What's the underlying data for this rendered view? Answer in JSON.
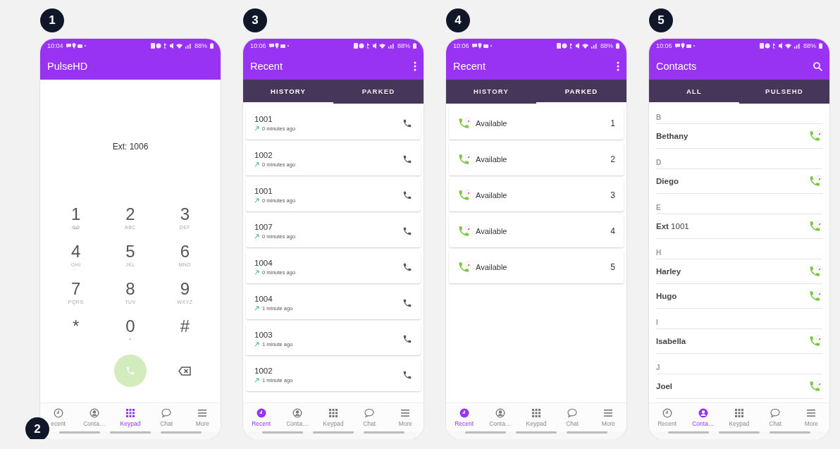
{
  "phones": [
    {
      "badge": "1",
      "corner_badge": "2",
      "status": {
        "time": "10:04",
        "battery": "88%"
      },
      "title": "PulseHD",
      "kind": "keypad",
      "extension": "Ext: 1006",
      "keys": [
        {
          "digit": "1",
          "voicemail": true
        },
        {
          "digit": "2",
          "letters": "ABC"
        },
        {
          "digit": "3",
          "letters": "DEF"
        },
        {
          "digit": "4",
          "letters": "GHI"
        },
        {
          "digit": "5",
          "letters": "JKL"
        },
        {
          "digit": "6",
          "letters": "MNO"
        },
        {
          "digit": "7",
          "letters": "PQRS"
        },
        {
          "digit": "8",
          "letters": "TUV"
        },
        {
          "digit": "9",
          "letters": "WXYZ"
        },
        {
          "digit": "*"
        },
        {
          "digit": "0",
          "letters": "+"
        },
        {
          "digit": "#"
        }
      ],
      "nav": [
        {
          "label": "ecent",
          "selected": false
        },
        {
          "label": "Conta…",
          "selected": false
        },
        {
          "label": "Keypad",
          "selected": true
        },
        {
          "label": "Chat",
          "selected": false
        },
        {
          "label": "More",
          "selected": false
        }
      ]
    },
    {
      "badge": "3",
      "status": {
        "time": "10:06",
        "battery": "88%"
      },
      "title": "Recent",
      "menu_button": true,
      "kind": "history",
      "tabs": [
        {
          "label": "HISTORY",
          "selected": true
        },
        {
          "label": "PARKED",
          "selected": false
        }
      ],
      "calls": [
        {
          "number": "1001",
          "time": "0 minutes ago"
        },
        {
          "number": "1002",
          "time": "0 minutes ago"
        },
        {
          "number": "1001",
          "time": "0 minutes ago"
        },
        {
          "number": "1007",
          "time": "0 minutes ago"
        },
        {
          "number": "1004",
          "time": "0 minutes ago"
        },
        {
          "number": "1004",
          "time": "1 minute ago"
        },
        {
          "number": "1003",
          "time": "1 minute ago"
        },
        {
          "number": "1002",
          "time": "1 minute ago"
        }
      ],
      "nav": [
        {
          "label": "Recent",
          "selected": true
        },
        {
          "label": "Conta…",
          "selected": false
        },
        {
          "label": "Keypad",
          "selected": false
        },
        {
          "label": "Chat",
          "selected": false
        },
        {
          "label": "More",
          "selected": false
        }
      ]
    },
    {
      "badge": "4",
      "status": {
        "time": "10:06",
        "battery": "88%"
      },
      "title": "Recent",
      "menu_button": true,
      "kind": "parked",
      "tabs": [
        {
          "label": "HISTORY",
          "selected": false
        },
        {
          "label": "PARKED",
          "selected": true
        }
      ],
      "slots": [
        {
          "label": "Available",
          "number": "1"
        },
        {
          "label": "Available",
          "number": "2"
        },
        {
          "label": "Available",
          "number": "3"
        },
        {
          "label": "Available",
          "number": "4"
        },
        {
          "label": "Available",
          "number": "5"
        }
      ],
      "nav": [
        {
          "label": "Recent",
          "selected": true
        },
        {
          "label": "Conta…",
          "selected": false
        },
        {
          "label": "Keypad",
          "selected": false
        },
        {
          "label": "Chat",
          "selected": false
        },
        {
          "label": "More",
          "selected": false
        }
      ]
    },
    {
      "badge": "5",
      "status": {
        "time": "10:06",
        "battery": "88%"
      },
      "title": "Contacts",
      "search_button": true,
      "kind": "contacts",
      "tabs": [
        {
          "label": "ALL",
          "selected": true
        },
        {
          "label": "PULSEHD",
          "selected": false
        }
      ],
      "sections": [
        {
          "letter": "B",
          "contacts": [
            {
              "name": "Bethany"
            }
          ]
        },
        {
          "letter": "D",
          "contacts": [
            {
              "name": "Diego"
            }
          ]
        },
        {
          "letter": "E",
          "contacts": [
            {
              "name": "Ext",
              "detail": "1001"
            }
          ]
        },
        {
          "letter": "H",
          "contacts": [
            {
              "name": "Harley"
            },
            {
              "name": "Hugo"
            }
          ]
        },
        {
          "letter": "I",
          "contacts": [
            {
              "name": "Isabella"
            }
          ]
        },
        {
          "letter": "J",
          "contacts": [
            {
              "name": "Joel"
            }
          ]
        }
      ],
      "nav": [
        {
          "label": "Recent",
          "selected": false
        },
        {
          "label": "Conta…",
          "selected": true
        },
        {
          "label": "Keypad",
          "selected": false
        },
        {
          "label": "Chat",
          "selected": false
        },
        {
          "label": "More",
          "selected": false
        }
      ]
    }
  ]
}
